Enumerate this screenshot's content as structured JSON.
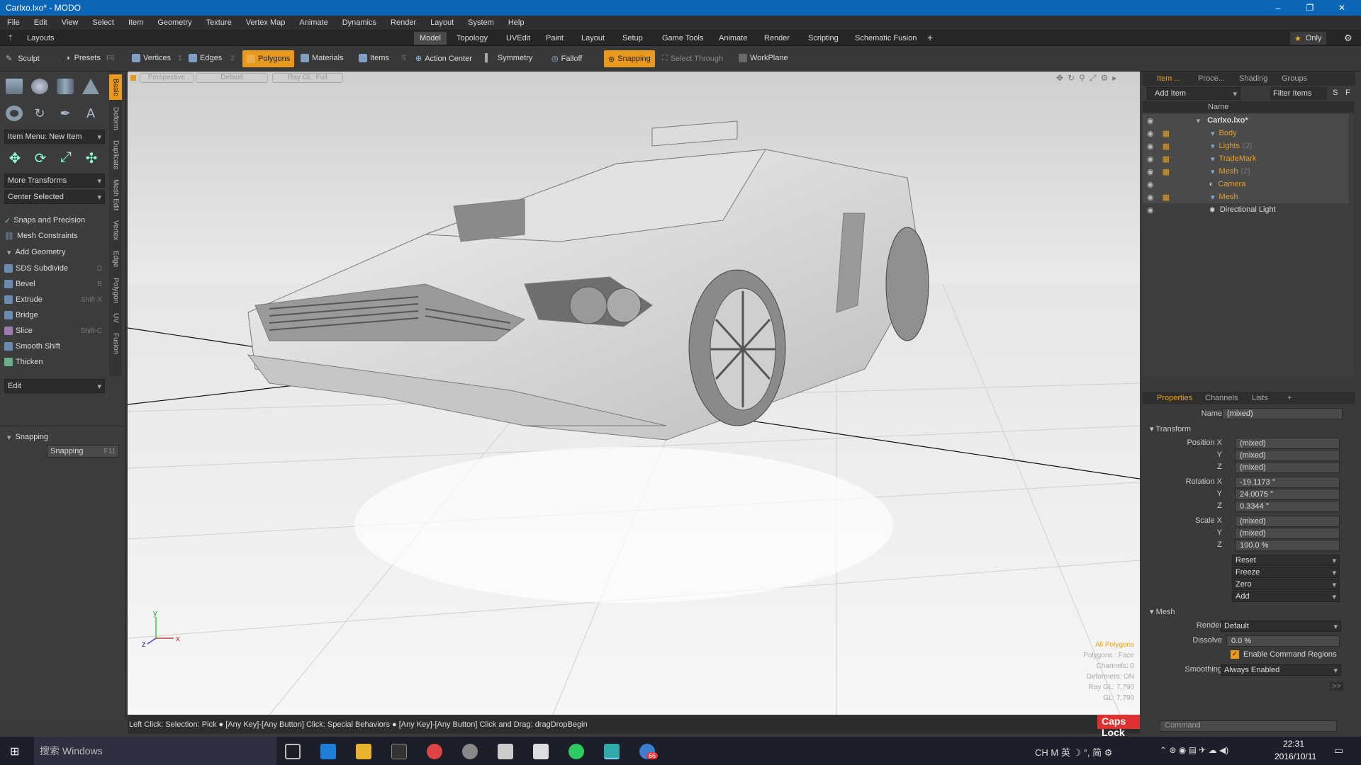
{
  "window": {
    "title": "Carlxo.lxo* - MODO",
    "minimize": "–",
    "restore": "❐",
    "close": "✕"
  },
  "menu": [
    "File",
    "Edit",
    "View",
    "Select",
    "Item",
    "Geometry",
    "Texture",
    "Vertex Map",
    "Animate",
    "Dynamics",
    "Render",
    "Layout",
    "System",
    "Help"
  ],
  "layouts_label": "Layouts",
  "tabs": [
    "Model",
    "Topology",
    "UVEdit",
    "Paint",
    "Layout",
    "Setup",
    "Game Tools",
    "Animate",
    "Render",
    "Scripting",
    "Schematic Fusion"
  ],
  "tab_add": "+",
  "only_label": "Only",
  "toolbar": {
    "sculpt": "Sculpt",
    "presets": "Presets",
    "presets_key": "F6",
    "vertices": "Vertices",
    "vertices_key": "1",
    "edges": "Edges",
    "edges_key": "2",
    "polygons": "Polygons",
    "materials": "Materials",
    "items": "Items",
    "items_key": "5",
    "action_center": "Action Center",
    "symmetry": "Symmetry",
    "falloff": "Falloff",
    "snapping": "Snapping",
    "select_through": "Select Through",
    "workplane": "WorkPlane"
  },
  "left": {
    "item_menu": "Item Menu: New Item",
    "more_transforms": "More Transforms",
    "center_selected": "Center Selected",
    "snaps": "Snaps and Precision",
    "mesh_constraints": "Mesh Constraints",
    "add_geometry": "Add Geometry",
    "tools": [
      {
        "label": "SDS Subdivide",
        "key": "D"
      },
      {
        "label": "Bevel",
        "key": "B"
      },
      {
        "label": "Extrude",
        "key": "Shift-X"
      },
      {
        "label": "Bridge",
        "key": ""
      },
      {
        "label": "Slice",
        "key": "Shift-C"
      },
      {
        "label": "Smooth Shift",
        "key": ""
      },
      {
        "label": "Thicken",
        "key": ""
      }
    ],
    "edit": "Edit",
    "snapping_header": "Snapping",
    "snapping_btn": "Snapping",
    "snapping_key": "F11"
  },
  "vtabs": [
    "Basic",
    "Deform",
    "Duplicate",
    "Mesh Edit",
    "Vertex",
    "Edge",
    "Polygon",
    "UV",
    "Fusion"
  ],
  "viewport": {
    "view": "Perspective",
    "shading": "Default",
    "render": "Ray GL: Full",
    "info": [
      "All Polygons",
      "Polygons : Face",
      "Channels: 0",
      "Deformers: ON",
      "Ray GL: 7,790",
      "GL: 7,790"
    ]
  },
  "status_bar": "Left Click: Selection: Pick ● [Any Key]-[Any Button] Click: Special Behaviors ● [Any Key]-[Any Button] Click and Drag: dragDropBegin",
  "caps_lock": "Caps Lock OFF",
  "right": {
    "tabs": [
      "Item ...",
      "Proce...",
      "Shading",
      "Groups"
    ],
    "add_item": "Add Item",
    "filter_items": "Filter Items",
    "s_btn": "S",
    "f_btn": "F",
    "name_col": "Name",
    "tree": [
      {
        "label": "Carlxo.lxo*",
        "count": ""
      },
      {
        "label": "Body",
        "count": ""
      },
      {
        "label": "Lights",
        "count": "(2)"
      },
      {
        "label": "TradeMark",
        "count": ""
      },
      {
        "label": "Mesh",
        "count": "(2)"
      },
      {
        "label": "Camera",
        "count": ""
      },
      {
        "label": "Mesh",
        "count": ""
      },
      {
        "label": "Directional Light",
        "count": ""
      }
    ],
    "prop_tabs": [
      "Properties",
      "Channels",
      "Lists",
      "+"
    ],
    "name_label": "Name",
    "name_value": "(mixed)",
    "transform": "Transform",
    "pos_label": "Position X",
    "rot_label": "Rotation X",
    "scale_label": "Scale X",
    "y": "Y",
    "z": "Z",
    "pos": [
      "(mixed)",
      "(mixed)",
      "(mixed)"
    ],
    "rot": [
      "-19.1173 °",
      "24.0075 °",
      "0.3344 °"
    ],
    "scale": [
      "(mixed)",
      "(mixed)",
      "100.0 %"
    ],
    "actions": [
      "Reset",
      "Freeze",
      "Zero",
      "Add"
    ],
    "mesh_header": "Mesh",
    "render_label": "Render",
    "render_value": "Default",
    "dissolve_label": "Dissolve",
    "dissolve_value": "0.0 %",
    "enable_cmd": "Enable Command Regions",
    "smoothing_label": "Smoothing",
    "smoothing_value": "Always Enabled",
    "more": ">>",
    "command_placeholder": "Command"
  },
  "taskbar": {
    "search": "搜索 Windows",
    "tray": "CH  M  英  ☽  °,  简  ⚙",
    "time": "22:31",
    "date": "2016/10/11",
    "badge": "66"
  }
}
